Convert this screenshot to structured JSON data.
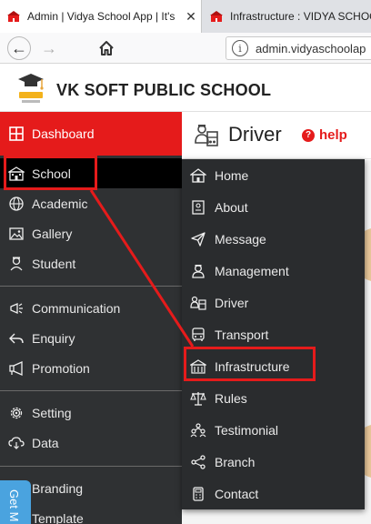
{
  "browser": {
    "tabs": [
      {
        "title": "Admin | Vidya School App | It's",
        "favicon": "school-favicon",
        "active": true
      },
      {
        "title": "Infrastructure : VIDYA SCHOO",
        "favicon": "school-favicon",
        "active": false
      }
    ],
    "close_glyph": "✕",
    "url_host": "admin.vidyaschoolap",
    "nav": {
      "back": "←",
      "forward": "→",
      "home": "⌂",
      "info": "i"
    }
  },
  "site": {
    "name": "VK SOFT PUBLIC SCHOOL",
    "logo_text": "VK SOFT"
  },
  "sidebar": {
    "dashboard": {
      "label": "Dashboard",
      "icon": "dashboard-icon"
    },
    "groups": [
      [
        {
          "label": "School",
          "icon": "school-icon",
          "active": true
        },
        {
          "label": "Academic",
          "icon": "globe-icon"
        },
        {
          "label": "Gallery",
          "icon": "image-icon"
        },
        {
          "label": "Student",
          "icon": "student-icon"
        }
      ],
      [
        {
          "label": "Communication",
          "icon": "megaphone-icon"
        },
        {
          "label": "Enquiry",
          "icon": "reply-icon"
        },
        {
          "label": "Promotion",
          "icon": "announce-icon"
        }
      ],
      [
        {
          "label": "Setting",
          "icon": "gear-icon"
        },
        {
          "label": "Data",
          "icon": "cloud-icon"
        }
      ],
      [
        {
          "label": "Branding",
          "icon": "brand-icon"
        },
        {
          "label": "Template",
          "icon": "template-icon"
        }
      ]
    ],
    "get_tab": "Get M"
  },
  "content": {
    "title": "Driver",
    "title_icon": "driver-icon",
    "help_label": "help",
    "help_icon": "question-icon"
  },
  "dropdown": {
    "items": [
      {
        "label": "Home",
        "icon": "home-school-icon"
      },
      {
        "label": "About",
        "icon": "document-icon"
      },
      {
        "label": "Message",
        "icon": "send-icon"
      },
      {
        "label": "Management",
        "icon": "manager-icon"
      },
      {
        "label": "Driver",
        "icon": "driver-icon"
      },
      {
        "label": "Transport",
        "icon": "bus-icon"
      },
      {
        "label": "Infrastructure",
        "icon": "building-icon",
        "highlighted": true
      },
      {
        "label": "Rules",
        "icon": "scales-icon"
      },
      {
        "label": "Testimonial",
        "icon": "people-icon"
      },
      {
        "label": "Branch",
        "icon": "share-icon"
      },
      {
        "label": "Contact",
        "icon": "phone-icon"
      }
    ]
  },
  "colors": {
    "accent_red": "#e51b1b",
    "sidebar_bg": "#2f3133",
    "dropdown_bg": "#2a2c2e",
    "get_tab_blue": "#4aa3df"
  }
}
